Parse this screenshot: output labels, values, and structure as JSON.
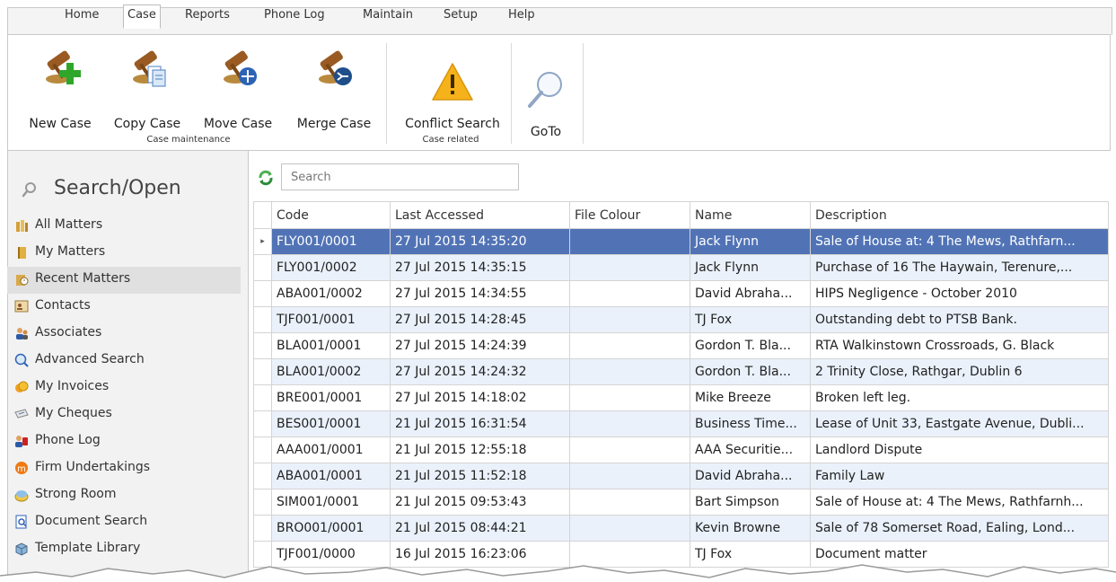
{
  "menu": {
    "tabs": [
      "Home",
      "Case",
      "Reports",
      "Phone Log",
      "Maintain",
      "Setup",
      "Help"
    ],
    "active_tab": "Case"
  },
  "ribbon": {
    "buttons": {
      "new_case": "New Case",
      "copy_case": "Copy Case",
      "move_case": "Move Case",
      "merge_case": "Merge Case",
      "conflict_search": "Conflict Search",
      "goto": "GoTo"
    },
    "groups": {
      "case_maintenance": "Case maintenance",
      "case_related": "Case related"
    }
  },
  "sidebar": {
    "title": "Search/Open",
    "items": [
      {
        "label": "All Matters",
        "icon": "books-icon"
      },
      {
        "label": "My Matters",
        "icon": "book-icon"
      },
      {
        "label": "Recent Matters",
        "icon": "recent-matters-icon"
      },
      {
        "label": "Contacts",
        "icon": "contacts-card-icon"
      },
      {
        "label": "Associates",
        "icon": "associates-icon"
      },
      {
        "label": "Advanced Search",
        "icon": "advanced-search-icon"
      },
      {
        "label": "My Invoices",
        "icon": "invoices-icon"
      },
      {
        "label": "My Cheques",
        "icon": "cheques-icon"
      },
      {
        "label": "Phone Log",
        "icon": "phone-log-icon"
      },
      {
        "label": "Firm Undertakings",
        "icon": "undertakings-icon"
      },
      {
        "label": "Strong Room",
        "icon": "strong-room-icon"
      },
      {
        "label": "Document Search",
        "icon": "document-search-icon"
      },
      {
        "label": "Template Library",
        "icon": "template-library-icon"
      }
    ],
    "active_item": "Recent Matters"
  },
  "search": {
    "placeholder": "Search"
  },
  "grid": {
    "columns": [
      "Code",
      "Last Accessed",
      "File Colour",
      "Name",
      "Description"
    ],
    "rows": [
      {
        "code": "FLY001/0001",
        "last_accessed": "27 Jul 2015 14:35:20",
        "file_colour": "",
        "name": "Jack Flynn",
        "description": "Sale of House at:  4 The Mews, Rathfarn..."
      },
      {
        "code": "FLY001/0002",
        "last_accessed": "27 Jul 2015 14:35:15",
        "file_colour": "",
        "name": "Jack Flynn",
        "description": "Purchase of 16 The Haywain, Terenure,..."
      },
      {
        "code": "ABA001/0002",
        "last_accessed": "27 Jul 2015 14:34:55",
        "file_colour": "",
        "name": "David Abraha...",
        "description": "HIPS Negligence - October 2010"
      },
      {
        "code": "TJF001/0001",
        "last_accessed": "27 Jul 2015 14:28:45",
        "file_colour": "",
        "name": "TJ Fox",
        "description": "Outstanding debt to PTSB Bank."
      },
      {
        "code": "BLA001/0001",
        "last_accessed": "27 Jul 2015 14:24:39",
        "file_colour": "",
        "name": "Gordon T. Bla...",
        "description": "RTA Walkinstown Crossroads, G. Black"
      },
      {
        "code": "BLA001/0002",
        "last_accessed": "27 Jul 2015 14:24:32",
        "file_colour": "",
        "name": "Gordon T. Bla...",
        "description": "2 Trinity Close, Rathgar, Dublin 6"
      },
      {
        "code": "BRE001/0001",
        "last_accessed": "27 Jul 2015 14:18:02",
        "file_colour": "",
        "name": "Mike Breeze",
        "description": "Broken left leg."
      },
      {
        "code": "BES001/0001",
        "last_accessed": "21 Jul 2015 16:31:54",
        "file_colour": "",
        "name": "Business Time...",
        "description": "Lease of Unit 33, Eastgate Avenue, Dubli..."
      },
      {
        "code": "AAA001/0001",
        "last_accessed": "21 Jul 2015 12:55:18",
        "file_colour": "",
        "name": "AAA Securitie...",
        "description": "Landlord Dispute"
      },
      {
        "code": "ABA001/0001",
        "last_accessed": "21 Jul 2015 11:52:18",
        "file_colour": "",
        "name": "David Abraha...",
        "description": "Family Law"
      },
      {
        "code": "SIM001/0001",
        "last_accessed": "21 Jul 2015 09:53:43",
        "file_colour": "",
        "name": "Bart Simpson",
        "description": "Sale of House at: 4 The Mews, Rathfarnh..."
      },
      {
        "code": "BRO001/0001",
        "last_accessed": "21 Jul 2015 08:44:21",
        "file_colour": "",
        "name": "Kevin Browne",
        "description": "Sale of 78 Somerset Road, Ealing, Lond..."
      },
      {
        "code": "TJF001/0000",
        "last_accessed": "16 Jul 2015 16:23:06",
        "file_colour": "",
        "name": "TJ Fox",
        "description": "Document matter"
      }
    ],
    "selected_row": 0,
    "row_indicator": "▸"
  },
  "colors": {
    "selected_row": "#5173b6",
    "alt_row": "#eaf1fb",
    "nav_bg": "#f2f2f2",
    "nav_active": "#e0e0e0"
  }
}
